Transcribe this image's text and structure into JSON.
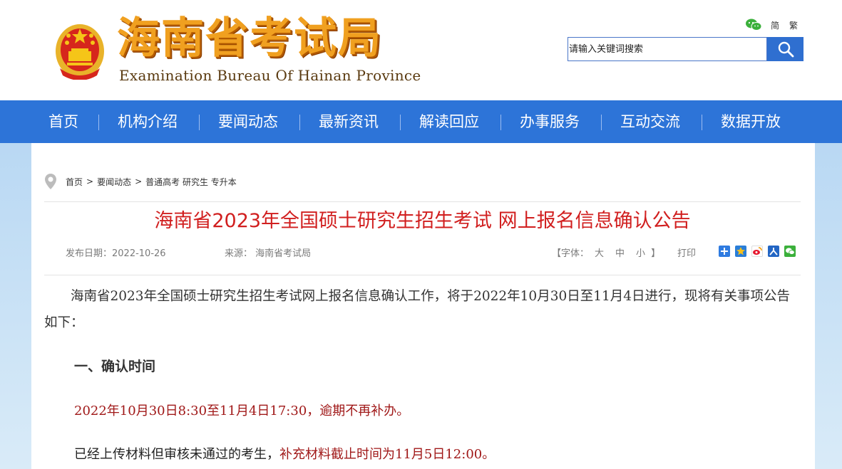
{
  "header": {
    "logo_cn": "海南省考试局",
    "logo_en": "Examination Bureau Of Hainan Province",
    "lang_simplified": "简",
    "lang_traditional": "繁",
    "search_placeholder": "请输入关键词搜索"
  },
  "nav": {
    "items": [
      {
        "label": "首页"
      },
      {
        "label": "机构介绍"
      },
      {
        "label": "要闻动态"
      },
      {
        "label": "最新资讯"
      },
      {
        "label": "解读回应"
      },
      {
        "label": "办事服务"
      },
      {
        "label": "互动交流"
      },
      {
        "label": "数据开放"
      }
    ]
  },
  "breadcrumb": {
    "items": [
      "首页",
      "要闻动态",
      "普通高考 研究生 专升本"
    ],
    "separator": ">"
  },
  "article": {
    "title": "海南省2023年全国硕士研究生招生考试 网上报名信息确认公告",
    "publish_date": "发布日期：2022-10-26",
    "source": "来源： 海南省考试局",
    "font_size_label": "【字体：",
    "font_large": "大",
    "font_medium": "中",
    "font_small": "小",
    "font_size_close": "】",
    "print": "打印",
    "intro": "海南省2023年全国硕士研究生招生考试网上报名信息确认工作，将于2022年10月30日至11月4日进行，现将有关事项公告如下：",
    "section1_heading": "一、确认时间",
    "section1_time": "2022年10月30日8:30至11月4日17:30，逾期不再补办。",
    "section1_note_black": "已经上传材料但审核未通过的考生，",
    "section1_note_red": "补充材料截止时间为11月5日12:00。"
  },
  "colors": {
    "nav_bg": "#2d74d8",
    "title_red": "#d11f1f",
    "logo_gold": "#f0a020"
  },
  "icons": {
    "emblem": "national-emblem-icon",
    "wechat": "wechat-icon",
    "search": "search-icon",
    "location": "location-pin-icon",
    "share": [
      "share-plus-icon",
      "qzone-icon",
      "weibo-icon",
      "renren-icon",
      "wechat-share-icon"
    ]
  }
}
